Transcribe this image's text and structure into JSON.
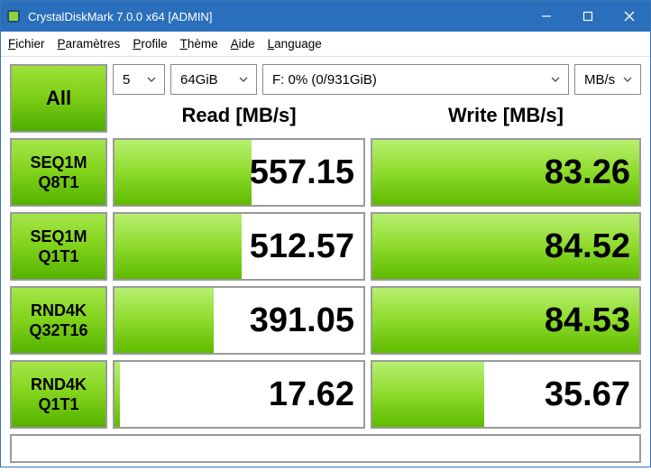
{
  "window": {
    "title": "CrystalDiskMark 7.0.0 x64 [ADMIN]"
  },
  "menu": {
    "file": {
      "pre": "",
      "key": "F",
      "post": "ichier"
    },
    "params": {
      "pre": "",
      "key": "P",
      "post": "aramètres"
    },
    "profile": {
      "pre": "",
      "key": "P",
      "post": "rofile"
    },
    "theme": {
      "pre": "",
      "key": "T",
      "post": "hème"
    },
    "help": {
      "pre": "",
      "key": "A",
      "post": "ide"
    },
    "language": {
      "pre": "",
      "key": "L",
      "post": "anguage"
    }
  },
  "controls": {
    "all_label": "All",
    "count": "5",
    "size": "64GiB",
    "drive": "F: 0% (0/931GiB)",
    "unit": "MB/s",
    "read_header": "Read [MB/s]",
    "write_header": "Write [MB/s]"
  },
  "tests": [
    {
      "line1": "SEQ1M",
      "line2": "Q8T1",
      "read": "557.15",
      "read_pct": 55,
      "write": "83.26",
      "write_pct": 100
    },
    {
      "line1": "SEQ1M",
      "line2": "Q1T1",
      "read": "512.57",
      "read_pct": 51,
      "write": "84.52",
      "write_pct": 100
    },
    {
      "line1": "RND4K",
      "line2": "Q32T16",
      "read": "391.05",
      "read_pct": 40,
      "write": "84.53",
      "write_pct": 100
    },
    {
      "line1": "RND4K",
      "line2": "Q1T1",
      "read": "17.62",
      "read_pct": 2,
      "write": "35.67",
      "write_pct": 42
    }
  ],
  "chart_data": {
    "type": "bar",
    "title": "CrystalDiskMark 7.0.0 — Read/Write throughput",
    "ylabel": "MB/s",
    "categories": [
      "SEQ1M Q8T1",
      "SEQ1M Q1T1",
      "RND4K Q32T16",
      "RND4K Q1T1"
    ],
    "series": [
      {
        "name": "Read",
        "values": [
          557.15,
          512.57,
          391.05,
          17.62
        ]
      },
      {
        "name": "Write",
        "values": [
          83.26,
          84.52,
          84.53,
          35.67
        ]
      }
    ]
  }
}
